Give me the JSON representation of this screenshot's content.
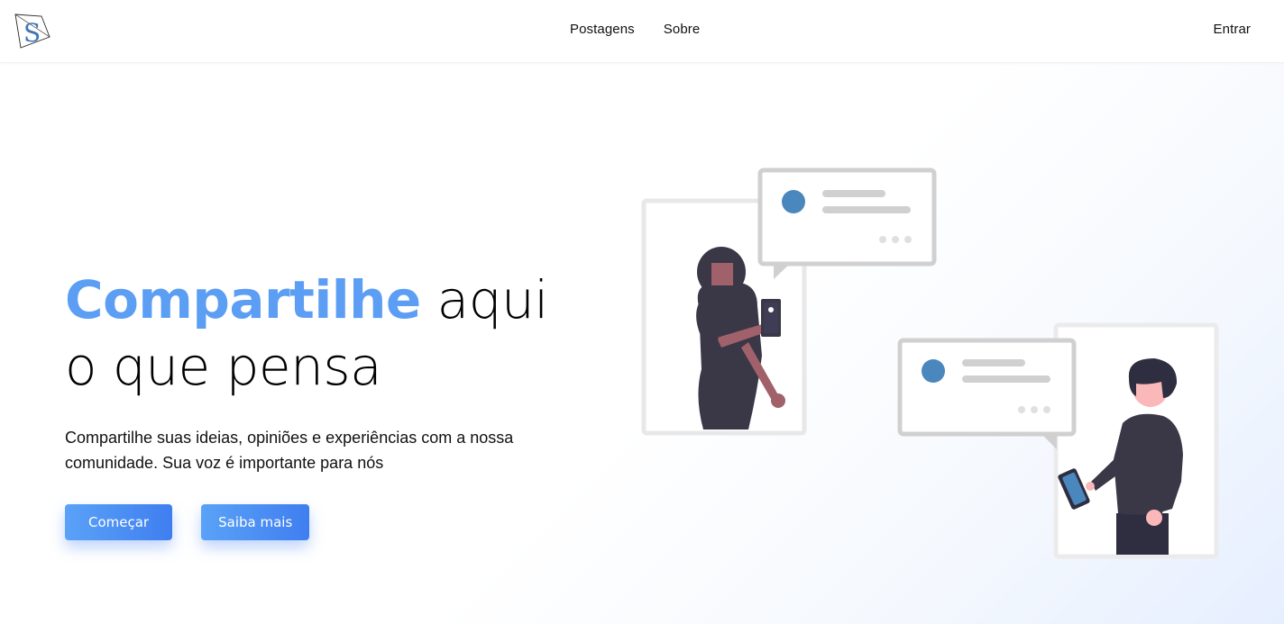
{
  "navbar": {
    "logo_letter": "S",
    "links": [
      "Postagens",
      "Sobre"
    ],
    "login": "Entrar"
  },
  "hero": {
    "headline_accent": "Compartilhe",
    "headline_rest_line1": " aqui",
    "headline_line2": "o que pensa",
    "description": "Compartilhe suas ideias, opiniões e experiências com a nossa comunidade. Sua voz é importante para nós",
    "primary_button": "Começar",
    "secondary_button": "Saiba mais"
  },
  "illustration": {
    "icon": "people-sharing-messages-illustration",
    "colors": {
      "frame": "#e6e6e6",
      "bubble": "#d0d0d0",
      "avatar_dot": "#4a87bd",
      "figure_dark": "#3a3747",
      "skin_dark": "#a0616a",
      "skin_light": "#fbb8b8"
    }
  }
}
